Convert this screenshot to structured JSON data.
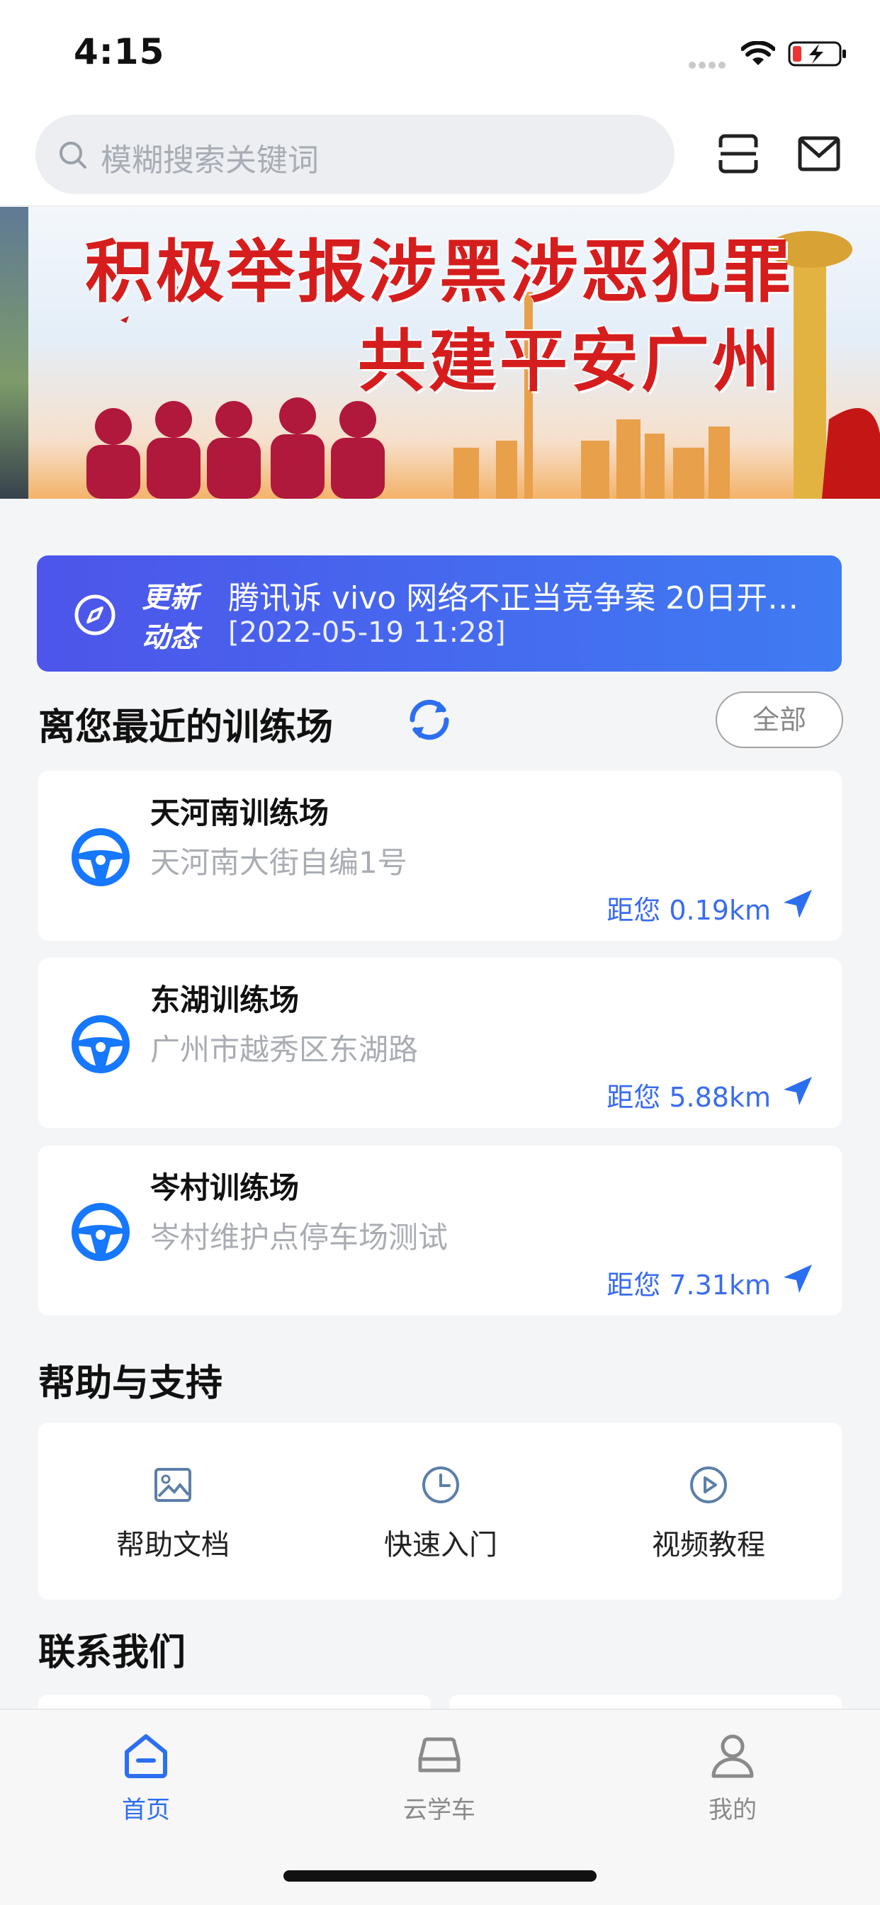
{
  "status_bar": {
    "time": "4:15"
  },
  "header": {
    "search_placeholder": "模糊搜索关键词"
  },
  "banner": {
    "line1": "积极举报涉黑涉恶犯罪",
    "line2": "共建平安广州"
  },
  "news": {
    "tag_line1": "更新",
    "tag_line2": "动态",
    "headline": "腾讯诉 vivo 网络不正当竞争案 20日开…",
    "timestamp": "[2022-05-19 11:28]"
  },
  "nearby": {
    "title": "离您最近的训练场",
    "all_label": "全部",
    "items": [
      {
        "name": "天河南训练场",
        "address": "天河南大街自编1号",
        "distance": "距您 0.19km"
      },
      {
        "name": "东湖训练场",
        "address": "广州市越秀区东湖路",
        "distance": "距您 5.88km"
      },
      {
        "name": "岑村训练场",
        "address": "岑村维护点停车场测试",
        "distance": "距您 7.31km"
      }
    ]
  },
  "help": {
    "title": "帮助与支持",
    "items": [
      {
        "label": "帮助文档",
        "icon": "image-icon"
      },
      {
        "label": "快速入门",
        "icon": "clock-icon"
      },
      {
        "label": "视频教程",
        "icon": "play-icon"
      }
    ]
  },
  "contact": {
    "title": "联系我们"
  },
  "tabs": [
    {
      "label": "首页",
      "icon": "home-icon",
      "active": true
    },
    {
      "label": "云学车",
      "icon": "car-icon",
      "active": false
    },
    {
      "label": "我的",
      "icon": "user-icon",
      "active": false
    }
  ],
  "colors": {
    "accent": "#2b6ef0",
    "news_bg_start": "#4d55ea",
    "news_bg_end": "#3f7bf2",
    "banner_red": "#d61d1d"
  }
}
